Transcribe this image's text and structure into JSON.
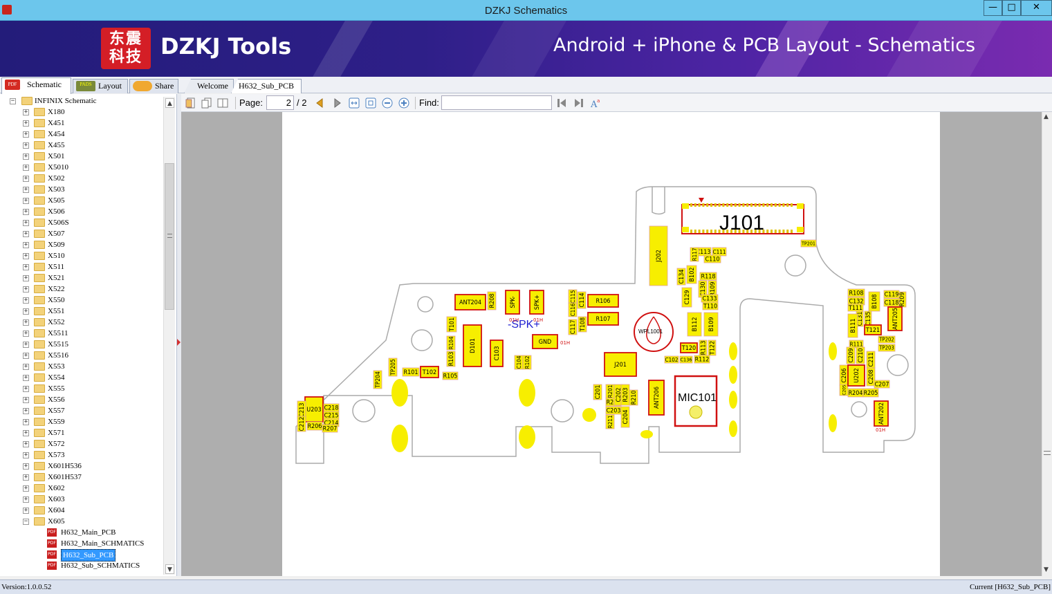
{
  "window": {
    "title": "DZKJ Schematics",
    "minimize_glyph": "—",
    "maximize_glyph": "□",
    "close_glyph": "✕"
  },
  "banner": {
    "logo_line1": "东震",
    "logo_line2": "科技",
    "brand": "DZKJ Tools",
    "tagline": "Android + iPhone & PCB Layout - Schematics"
  },
  "main_tabs": [
    {
      "label": "Schematic",
      "icon": "pdf-icon",
      "active": true
    },
    {
      "label": "Layout",
      "icon": "pads-icon",
      "active": false
    },
    {
      "label": "Share",
      "icon": "cloud-share-icon",
      "active": false
    }
  ],
  "doc_tabs": [
    {
      "label": "Welcome",
      "active": false
    },
    {
      "label": "H632_Sub_PCB",
      "active": true,
      "close_glyph": "✕"
    }
  ],
  "tree": {
    "root": "INFINIX Schematic",
    "folders": [
      "X180",
      "X451",
      "X454",
      "X455",
      "X501",
      "X5010",
      "X502",
      "X503",
      "X505",
      "X506",
      "X506S",
      "X507",
      "X509",
      "X510",
      "X511",
      "X521",
      "X522",
      "X550",
      "X551",
      "X552",
      "X5511",
      "X5515",
      "X5516",
      "X553",
      "X554",
      "X555",
      "X556",
      "X557",
      "X559",
      "X571",
      "X572",
      "X573",
      "X601H536",
      "X601H537",
      "X602",
      "X603",
      "X604"
    ],
    "open_folder": "X605",
    "files": [
      "H632_Main_PCB",
      "H632_Main_SCHMATICS",
      "H632_Sub_PCB",
      "H632_Sub_SCHMATICS"
    ],
    "selected_file": "H632_Sub_PCB"
  },
  "toolbar": {
    "page_label": "Page:",
    "page_current": "2",
    "page_total": "/ 2",
    "find_label": "Find:",
    "find_value": ""
  },
  "pcb": {
    "connector": "J101",
    "labels": [
      "TP201",
      "J202",
      "C113",
      "C111",
      "C110",
      "R117",
      "B102",
      "C134",
      "R118",
      "C130",
      "R109",
      "C133",
      "C129",
      "T110",
      "B112",
      "B109",
      "T120",
      "R113",
      "T122",
      "R112",
      "C136",
      "C102",
      "ANT204",
      "R208",
      "SPK-",
      "SPK+",
      "C115",
      "C116",
      "C114",
      "R106",
      "R107",
      "C117",
      "T108",
      "T101",
      "D101",
      "C103",
      "R104",
      "R103",
      "C104",
      "R102",
      "GND",
      "J201",
      "WPL1001",
      "MIC101",
      "ANT206",
      "C201",
      "R201",
      "R202",
      "C203",
      "C202",
      "R203",
      "C204",
      "R211",
      "R210",
      "R209",
      "TP204",
      "TP205",
      "R101",
      "T102",
      "R105",
      "U203",
      "C213",
      "C212",
      "C218",
      "C215",
      "C214",
      "R206",
      "R207",
      "R108",
      "C132",
      "B108",
      "C119",
      "C118",
      "T111",
      "C131",
      "C135",
      "B111",
      "T121",
      "ANT205",
      "R111",
      "TP202",
      "TP203",
      "C209",
      "C210",
      "C211",
      "C206",
      "C205",
      "U202",
      "C208",
      "C207",
      "R204",
      "R205",
      "ANT202"
    ],
    "spk_text": "-SPK+",
    "small_marks": [
      "01H",
      "01H",
      "01H",
      "01H"
    ]
  },
  "status": {
    "version": "Version:1.0.0.52",
    "current": "Current [H632_Sub_PCB]"
  }
}
